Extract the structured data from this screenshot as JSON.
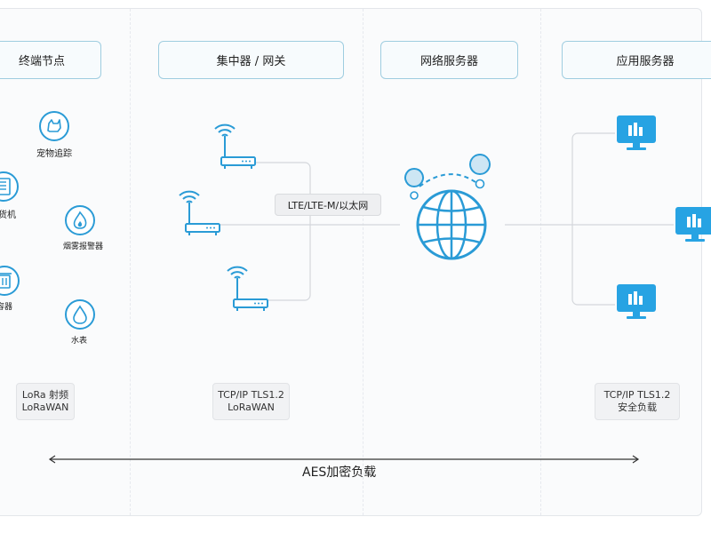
{
  "columns": {
    "end_nodes": "终端节点",
    "gateway": "集中器 / 网关",
    "network_server": "网络服务器",
    "app_server": "应用服务器"
  },
  "devices": {
    "pet_tracker": "宠物追踪",
    "vending": "售货机",
    "smoke": "烟雾报警器",
    "trash": "垃圾容器",
    "water_meter": "水表"
  },
  "link_label": "LTE/LTE-M/以太网",
  "protocols": {
    "end_nodes": [
      "LoRa 射频",
      "LoRaWAN"
    ],
    "gateway": [
      "TCP/IP TLS1.2",
      "LoRaWAN"
    ],
    "app_server": [
      "TCP/IP TLS1.2",
      "安全负载"
    ]
  },
  "footer": "AES加密负载",
  "colors": {
    "accent": "#2a9bd6",
    "monitor": "#27a3e3",
    "header_border": "#9fcde0"
  }
}
